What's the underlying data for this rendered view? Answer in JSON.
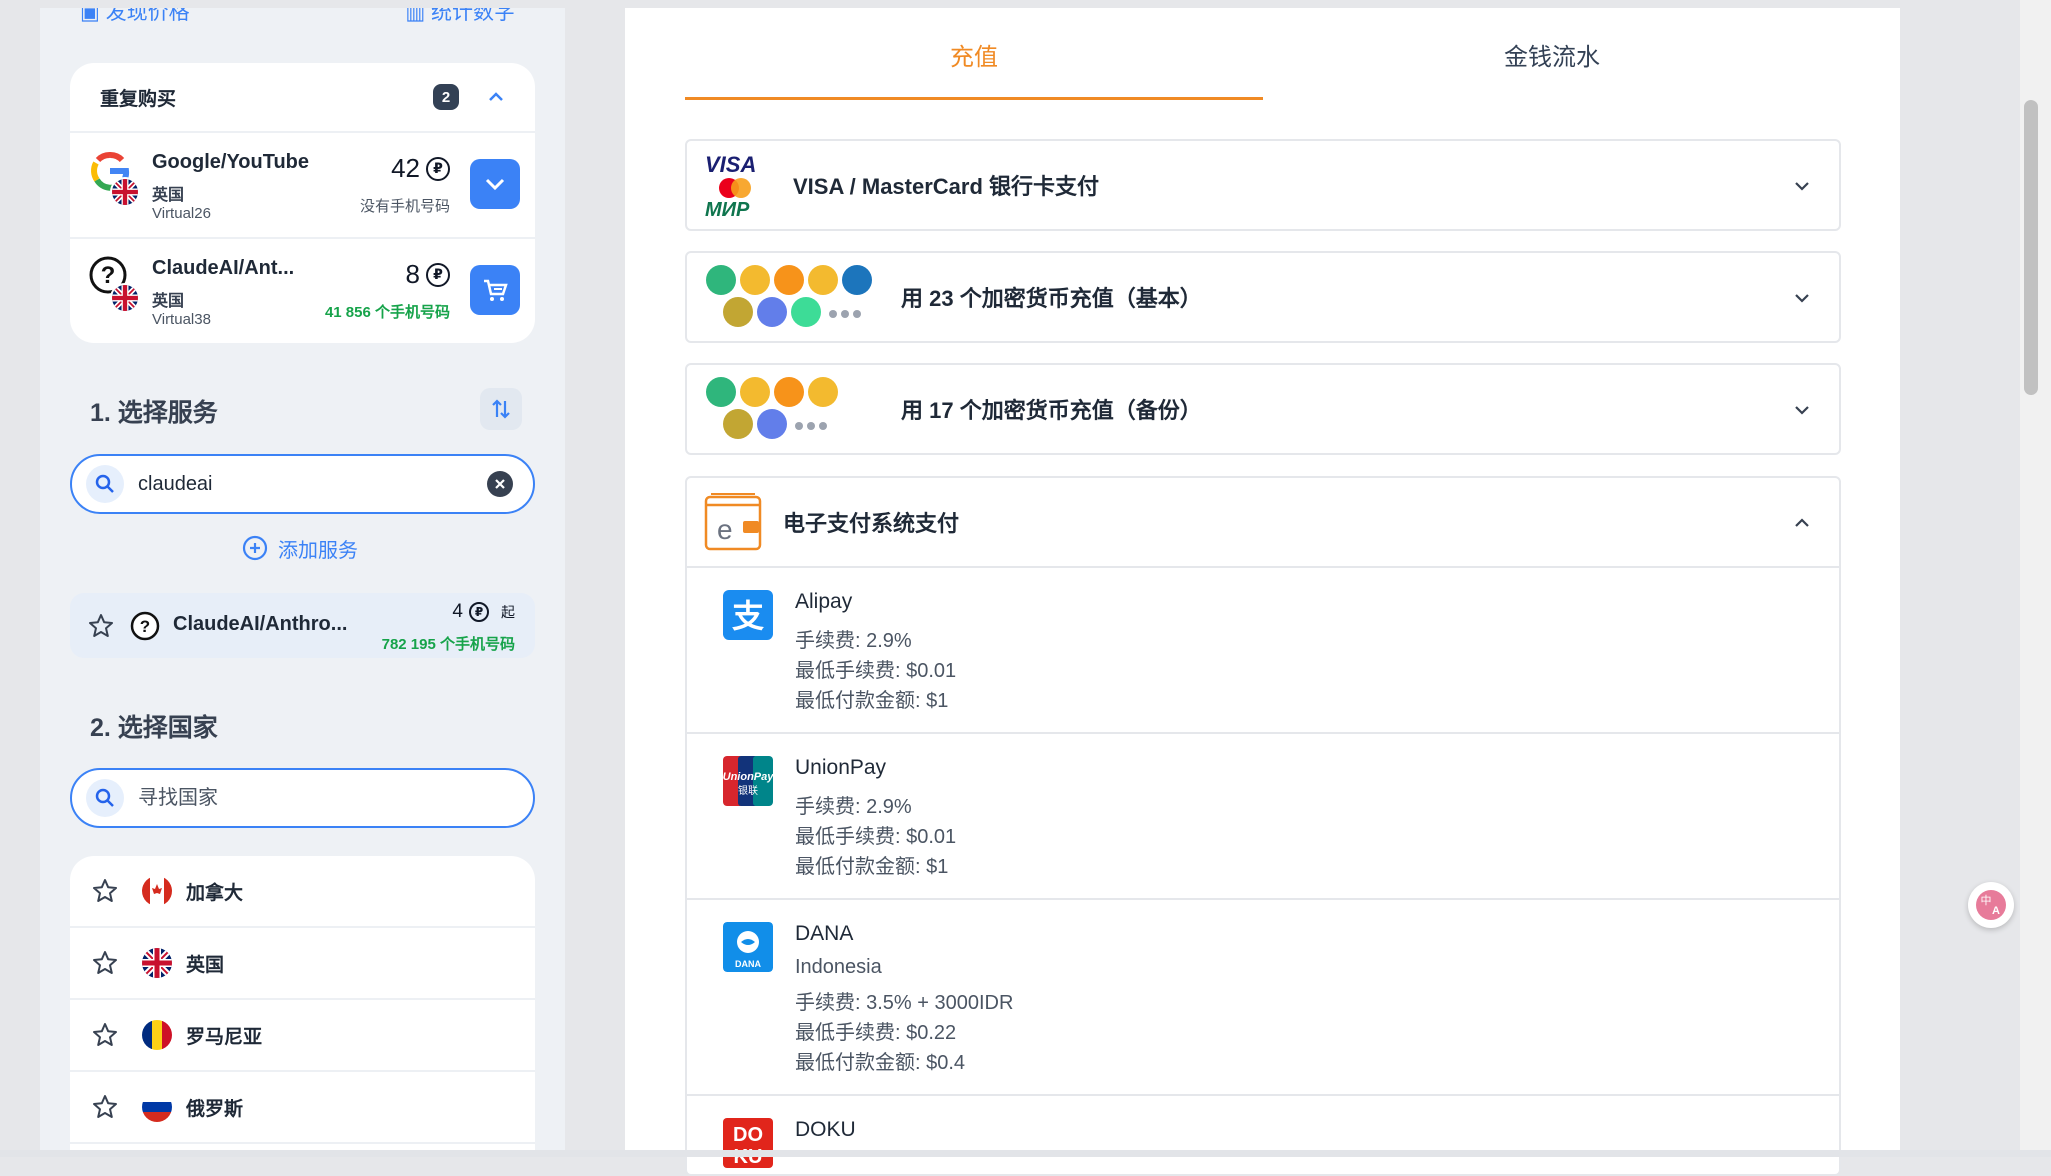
{
  "sidebar": {
    "top_left_label": "发现价格",
    "top_right_label": "统计数字",
    "repeat": {
      "title": "重复购买",
      "count": "2",
      "items": [
        {
          "name": "Google/YouTube",
          "country": "英国",
          "provider": "Virtual26",
          "price": "42",
          "availability": "没有手机号码"
        },
        {
          "name": "ClaudeAI/Ant...",
          "country": "英国",
          "provider": "Virtual38",
          "price": "8",
          "availability": "41 856 个手机号码"
        }
      ]
    },
    "service_section": {
      "title": "1. 选择服务",
      "search_value": "claudeai",
      "add_label": "添加服务",
      "result": {
        "name": "ClaudeAI/Anthro...",
        "price": "4",
        "price_suffix": "起",
        "availability": "782 195 个手机号码"
      }
    },
    "country_section": {
      "title": "2. 选择国家",
      "search_placeholder": "寻找国家",
      "countries": [
        "加拿大",
        "英国",
        "罗马尼亚",
        "俄罗斯"
      ]
    }
  },
  "main": {
    "tabs": [
      "充值",
      "金钱流水"
    ],
    "methods": [
      {
        "label": "VISA / MasterCard 银行卡支付"
      },
      {
        "label": "用 23 个加密货币充值（基本）"
      },
      {
        "label": "用 17 个加密货币充值（备份）"
      }
    ],
    "epay": {
      "title": "电子支付系统支付",
      "items": [
        {
          "name": "Alipay",
          "lines": [
            "手续费: 2.9%",
            "最低手续费: $0.01",
            "最低付款金额: $1"
          ]
        },
        {
          "name": "UnionPay",
          "lines": [
            "手续费: 2.9%",
            "最低手续费: $0.01",
            "最低付款金额: $1"
          ]
        },
        {
          "name": "DANA",
          "lines": [
            "Indonesia",
            "手续费: 3.5% + 3000IDR",
            "最低手续费: $0.22",
            "最低付款金额: $0.4"
          ]
        },
        {
          "name": "DOKU",
          "lines": []
        }
      ]
    }
  },
  "colors": {
    "accent_blue": "#3b82f6",
    "accent_orange": "#f08a24",
    "green": "#16a34a"
  }
}
